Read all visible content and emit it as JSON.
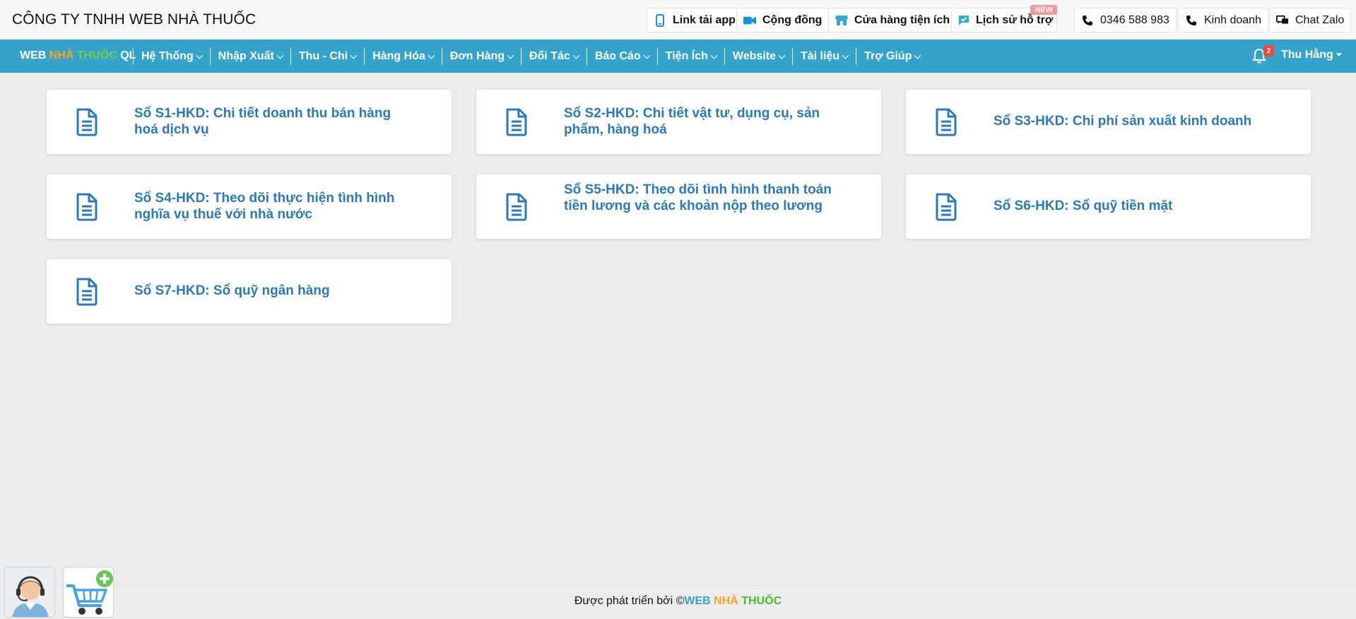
{
  "header": {
    "company": "CÔNG TY TNHH WEB NHÀ THUỐC",
    "buttons": {
      "app": "Link tải app",
      "community": "Cộng đồng",
      "store": "Cửa hàng tiện ích",
      "support_history": "Lịch sử hỗ trợ",
      "new_badge": "NEW",
      "phone": "0346 588 983",
      "sales": "Kinh doanh",
      "zalo": "Chat Zalo"
    }
  },
  "nav": {
    "brand": {
      "p1": "WEB ",
      "p2": "NHÀ ",
      "p3": "THUỐC",
      "p4": " QL"
    },
    "items": [
      "Hệ Thống",
      "Nhập Xuất",
      "Thu - Chi",
      "Hàng Hóa",
      "Đơn Hàng",
      "Đối Tác",
      "Báo Cáo",
      "Tiện Ích",
      "Website",
      "Tài liệu",
      "Trợ Giúp"
    ],
    "notifications": "2",
    "user": "Thu Hằng"
  },
  "cards": [
    "Sổ S1-HKD: Chi tiết doanh thu bán hàng hoá dịch vụ",
    "Sổ S2-HKD: Chi tiết vật tư, dụng cụ, sản phẩm, hàng hoá",
    "Sổ S3-HKD: Chi phí sản xuất kinh doanh",
    "Sổ S4-HKD: Theo dõi thực hiện tình hình nghĩa vụ thuế với nhà nước",
    "Sổ S5-HKD: Theo dõi tình hình thanh toán tiền lương và các khoản nộp theo lương",
    "Sổ S6-HKD: Sổ quỹ tiền mặt",
    "Sổ S7-HKD: Sổ quỹ ngân hàng"
  ],
  "footer": {
    "prefix": "Được phát triển bởi ©",
    "b1": "WEB ",
    "b2": "NHÀ ",
    "b3": "THUỐC"
  },
  "colors": {
    "nav_bg": "#36a3cd",
    "card_title": "#2e78b7",
    "page_bg": "#ececec"
  }
}
